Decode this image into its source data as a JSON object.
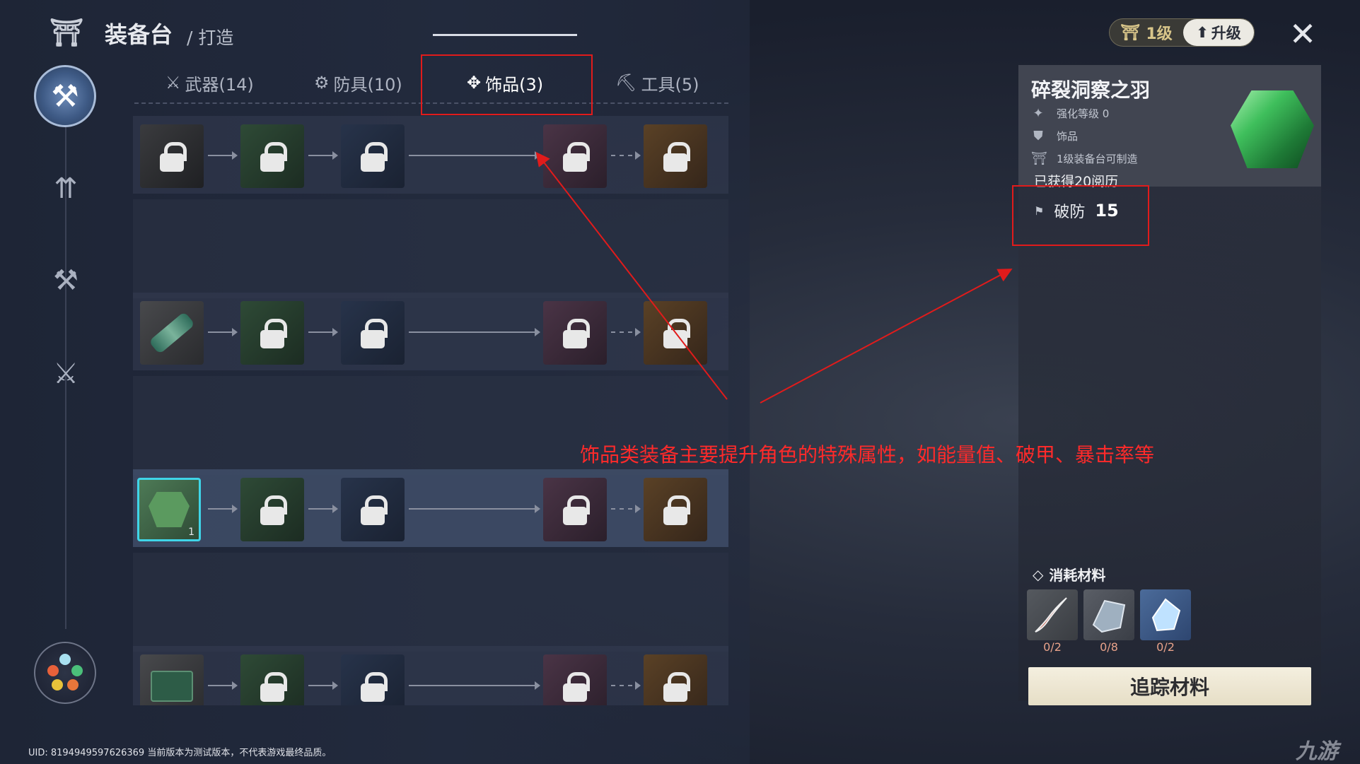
{
  "header": {
    "title": "装备台",
    "subtitle": "/ 打造",
    "level_label": "1级",
    "upgrade_label": "升级"
  },
  "tabs": [
    {
      "label": "武器(14)",
      "icon": "sword-icon",
      "active": false
    },
    {
      "label": "防具(10)",
      "icon": "shield-icon",
      "active": false
    },
    {
      "label": "饰品(3)",
      "icon": "accessory-icon",
      "active": true
    },
    {
      "label": "工具(5)",
      "icon": "pickaxe-icon",
      "active": false
    }
  ],
  "grid": {
    "rows": [
      {
        "type": "locked-accessory",
        "cells": [
          "black",
          "green",
          "blue",
          "purple",
          "orange"
        ]
      },
      {
        "type": "tube",
        "cells": [
          "grey",
          "green",
          "blue",
          "purple",
          "orange"
        ]
      },
      {
        "type": "gem",
        "cells": [
          "selected",
          "green",
          "blue",
          "purple",
          "orange"
        ],
        "selected_count": "1"
      },
      {
        "type": "board",
        "cells": [
          "grey",
          "green",
          "blue",
          "purple",
          "orange"
        ]
      }
    ]
  },
  "detail": {
    "item_name": "碎裂洞察之羽",
    "enhance_level": "强化等级 0",
    "category": "饰品",
    "craft_req": "1级装备台可制造",
    "obtained": "已获得20阅历",
    "stat_name": "破防",
    "stat_value": "15",
    "materials_title": "消耗材料",
    "materials": [
      {
        "name": "claw",
        "count": "0/2"
      },
      {
        "name": "ore",
        "count": "0/8"
      },
      {
        "name": "crystal",
        "count": "0/2"
      }
    ],
    "track_button": "追踪材料"
  },
  "annotation": {
    "text": "饰品类装备主要提升角色的特殊属性，如能量值、破甲、暴击率等",
    "color": "#ff2a2a"
  },
  "footer": {
    "uid_text": "UID: 8194949597626369 当前版本为测试版本，不代表游戏最终品质。",
    "watermark": "九游"
  }
}
